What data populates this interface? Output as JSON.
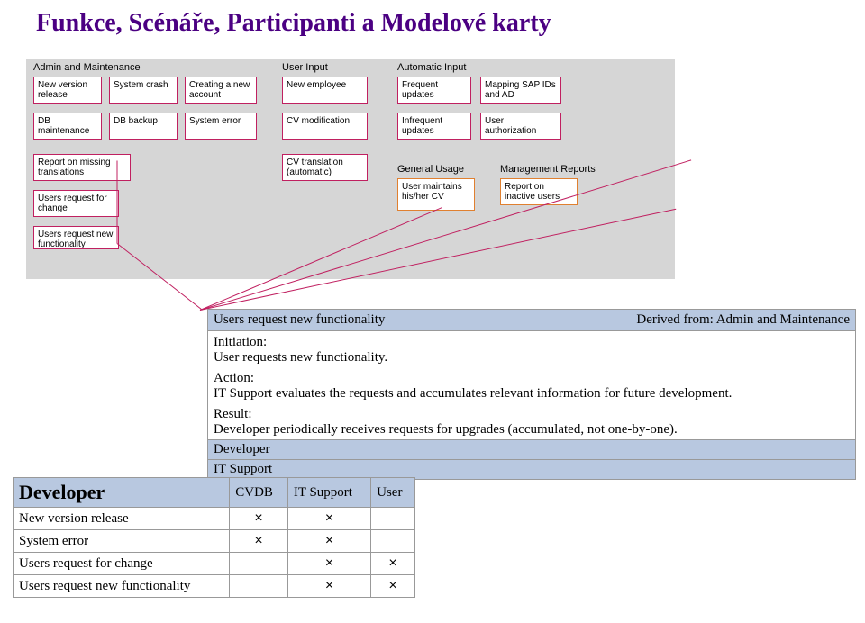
{
  "title": "Funkce, Scénáře, Participanti a Modelové karty",
  "groups": {
    "admin": {
      "label": "Admin and Maintenance",
      "cards": [
        "New version release",
        "System crash",
        "Creating a new account",
        "DB maintenance",
        "DB backup",
        "System error",
        "Report on missing translations",
        "Users request for change",
        "Users request new functionality"
      ]
    },
    "userInput": {
      "label": "User Input",
      "cards": [
        "New employee",
        "CV modification",
        "CV translation (automatic)"
      ]
    },
    "auto": {
      "label": "Automatic Input",
      "cards": [
        "Frequent updates",
        "Mapping SAP IDs and AD",
        "Infrequent updates",
        "User authorization"
      ]
    },
    "general": {
      "label": "General Usage",
      "cards": [
        "User maintains his/her CV"
      ]
    },
    "reports": {
      "label": "Management Reports",
      "cards": [
        "Report on inactive users"
      ]
    }
  },
  "scenario": {
    "name": "Users request new functionality",
    "derived": "Derived from: Admin and Maintenance",
    "initiation_label": "Initiation:",
    "initiation": "User requests new functionality.",
    "action_label": "Action:",
    "action": "IT Support evaluates the requests and accumulates relevant information for future development.",
    "result_label": "Result:",
    "result": "Developer periodically receives requests for upgrades (accumulated, not one-by-one).",
    "participants": [
      "Developer",
      "IT Support"
    ]
  },
  "resp": {
    "actor": "Developer",
    "cols": [
      "CVDB",
      "IT Support",
      "User"
    ],
    "rows": [
      {
        "label": "New version release",
        "marks": [
          true,
          true,
          false
        ]
      },
      {
        "label": "System error",
        "marks": [
          true,
          true,
          false
        ]
      },
      {
        "label": "Users request for change",
        "marks": [
          false,
          true,
          true
        ]
      },
      {
        "label": "Users request new functionality",
        "marks": [
          false,
          true,
          true
        ]
      }
    ]
  },
  "mark": "×"
}
